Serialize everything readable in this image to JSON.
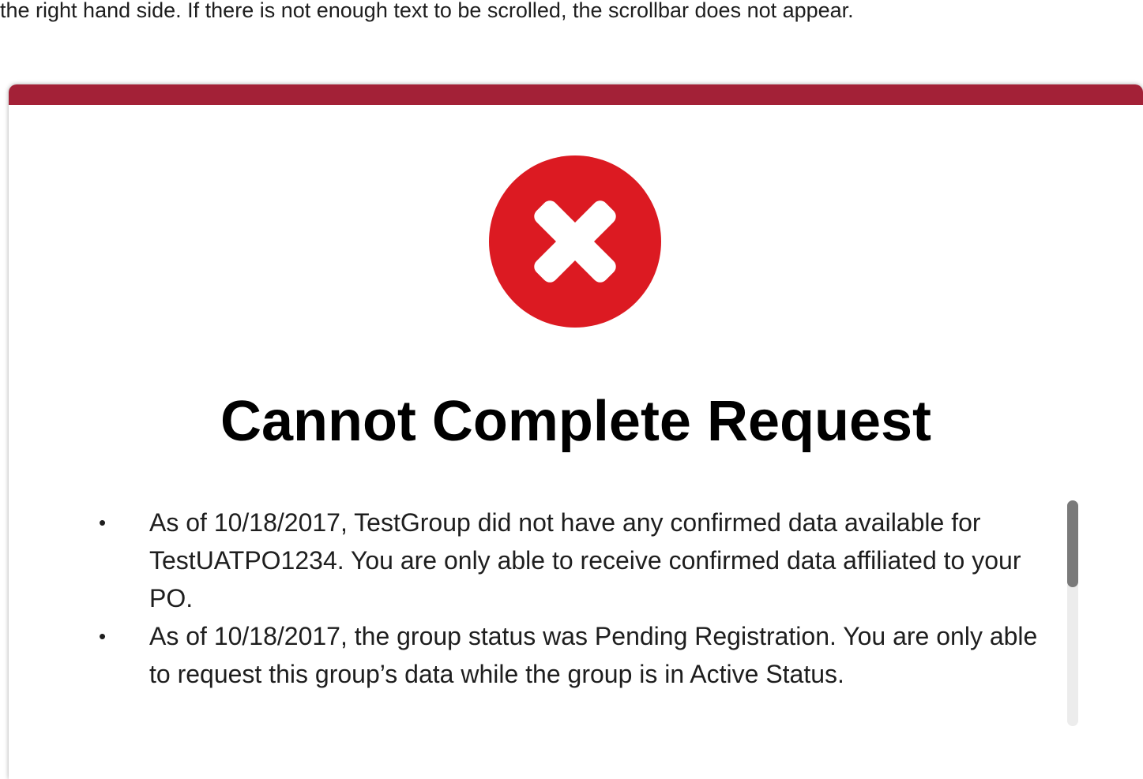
{
  "intro": {
    "text": "the right hand side. If there is not enough text to be scrolled, the scrollbar does not appear."
  },
  "modal": {
    "accent_color": "#a32137",
    "icon": "error-x-icon",
    "icon_color": "#dc1a22",
    "title": "Cannot Complete Request",
    "bullet_char": "•",
    "messages": [
      "As of 10/18/2017, TestGroup did not have any confirmed data available for TestUATPO1234. You are only able to receive confirmed data affiliated to your PO.",
      "As of 10/18/2017, the group status was Pending Registration. You are only able to request this group’s data while the group is in Active Status."
    ]
  }
}
